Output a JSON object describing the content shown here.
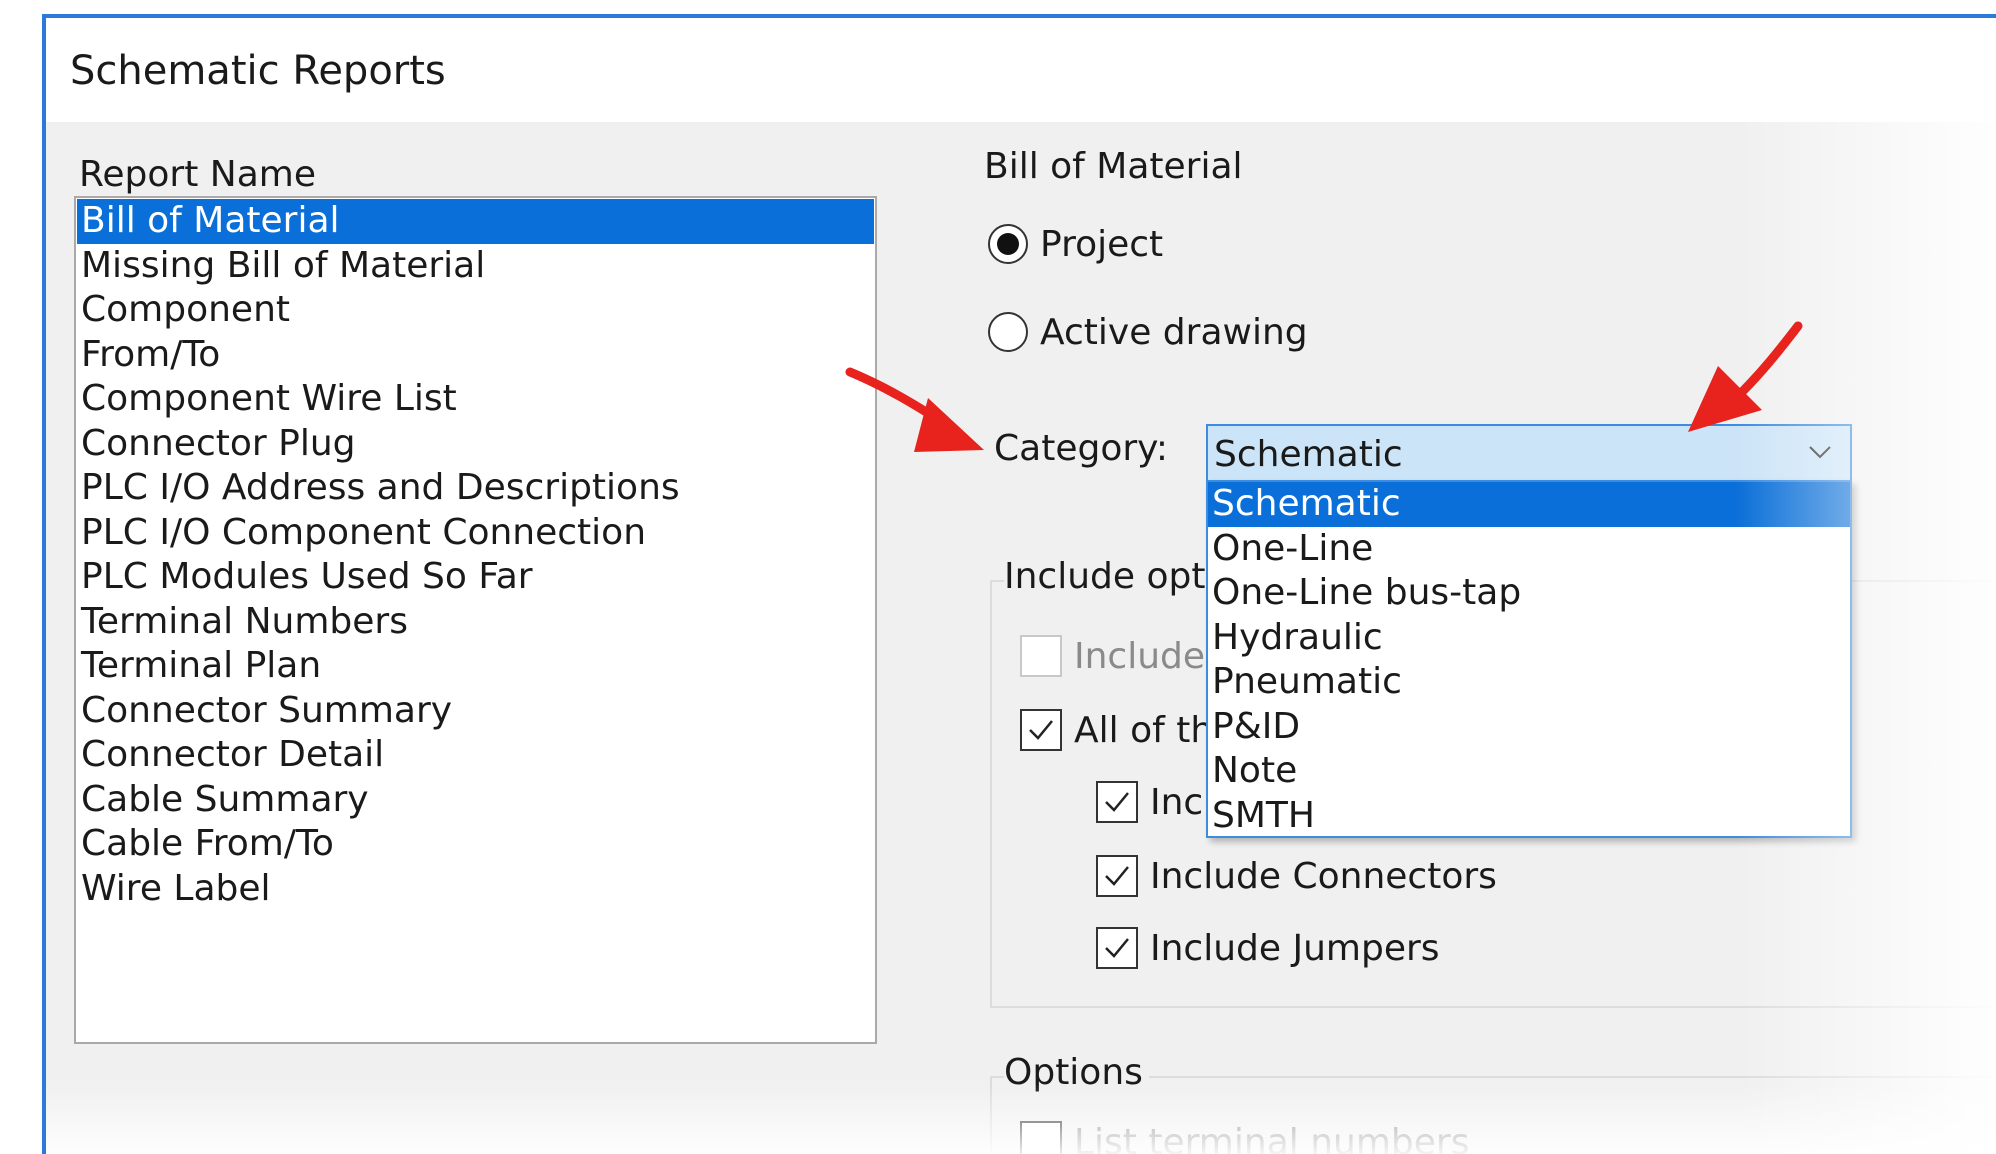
{
  "window": {
    "title": "Schematic Reports"
  },
  "report_list": {
    "label": "Report Name",
    "items": [
      "Bill of Material",
      "Missing Bill of Material",
      "Component",
      "From/To",
      "Component Wire List",
      "Connector Plug",
      "PLC I/O Address and Descriptions",
      "PLC I/O Component Connection",
      "PLC Modules Used So Far",
      "Terminal Numbers",
      "Terminal Plan",
      "Connector Summary",
      "Connector Detail",
      "Cable Summary",
      "Cable From/To",
      "Wire Label"
    ],
    "selected": "Bill of Material"
  },
  "bom": {
    "group_title": "Bill of Material",
    "radio_project": "Project",
    "radio_active": "Active drawing",
    "selected_radio": "Project",
    "category_label": "Category:",
    "category_value": "Schematic",
    "category_options": [
      "Schematic",
      "One-Line",
      "One-Line bus-tap",
      "Hydraulic",
      "Pneumatic",
      "P&ID",
      "Note",
      "SMTH"
    ]
  },
  "include_options": {
    "title": "Include opti",
    "items": [
      {
        "label": "Include",
        "checked": false,
        "enabled": false
      },
      {
        "label": "All of th",
        "checked": true,
        "enabled": true
      },
      {
        "label": "Inc",
        "checked": true,
        "enabled": true
      },
      {
        "label": "Include Connectors",
        "checked": true,
        "enabled": true
      },
      {
        "label": "Include Jumpers",
        "checked": true,
        "enabled": true
      }
    ]
  },
  "options": {
    "title": "Options",
    "items": [
      {
        "label": "List terminal numbers",
        "checked": false,
        "enabled": true
      }
    ]
  },
  "colors": {
    "window_border": "#2b79d8",
    "selection": "#0a6fd8",
    "combo_background": "#cce4f7",
    "combo_border": "#3c8ce0",
    "arrow_red": "#e8221c"
  },
  "icons": {
    "combo_dropdown": "chevron-down-icon",
    "checkmark": "checkmark-icon",
    "callout_arrow": "red-arrow-icon"
  }
}
